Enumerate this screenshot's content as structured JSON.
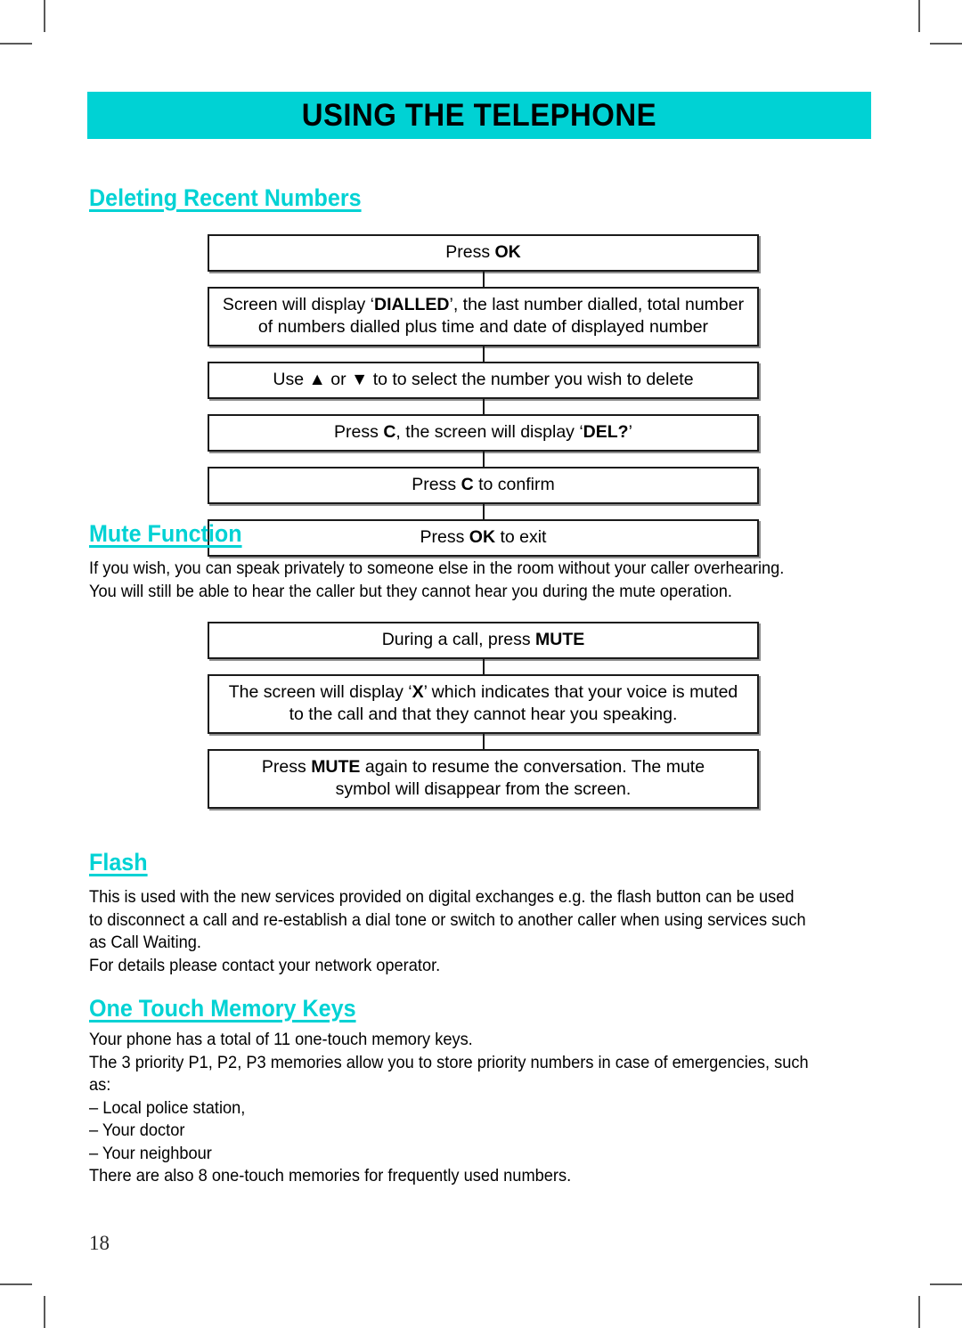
{
  "banner": {
    "title": "USING THE TELEPHONE"
  },
  "sections": {
    "deleting": {
      "heading": "Deleting Recent Numbers",
      "steps": [
        {
          "lines": [
            {
              "text": "Press ",
              "bold": false
            },
            {
              "text": "OK",
              "bold": true
            }
          ]
        },
        {
          "lines": [
            {
              "text": "Screen will display ‘",
              "bold": false
            },
            {
              "text": "DIALLED",
              "bold": true
            },
            {
              "text": "’, the last number dialled, total number",
              "bold": false
            },
            {
              "text": "|BR|",
              "bold": false
            },
            {
              "text": "of numbers dialled plus time and date of displayed number",
              "bold": false
            }
          ]
        },
        {
          "lines": [
            {
              "text": "Use ▲ or ▼ to to select the number you wish to delete",
              "bold": false
            }
          ]
        },
        {
          "lines": [
            {
              "text": "Press ",
              "bold": false
            },
            {
              "text": "C",
              "bold": true
            },
            {
              "text": ", the screen will display ‘",
              "bold": false
            },
            {
              "text": "DEL?",
              "bold": true
            },
            {
              "text": "’",
              "bold": false
            }
          ]
        },
        {
          "lines": [
            {
              "text": "Press ",
              "bold": false
            },
            {
              "text": "C",
              "bold": true
            },
            {
              "text": " to confirm",
              "bold": false
            }
          ]
        },
        {
          "lines": [
            {
              "text": "Press ",
              "bold": false
            },
            {
              "text": "OK",
              "bold": true
            },
            {
              "text": " to exit",
              "bold": false
            }
          ]
        }
      ]
    },
    "mute": {
      "heading": "Mute Function",
      "paragraph": [
        "If you wish, you can speak privately to someone else in the room without your caller overhearing.",
        "You will still be able to hear the caller but they cannot hear you during the mute operation."
      ],
      "steps": [
        {
          "lines": [
            {
              "text": "During a call, press ",
              "bold": false
            },
            {
              "text": "MUTE",
              "bold": true
            }
          ]
        },
        {
          "lines": [
            {
              "text": "The screen will display ‘",
              "bold": false
            },
            {
              "text": "X",
              "bold": true
            },
            {
              "text": "’ which indicates that your voice is muted",
              "bold": false
            },
            {
              "text": "|BR|",
              "bold": false
            },
            {
              "text": "to the call and that they cannot hear you speaking.",
              "bold": false
            }
          ]
        },
        {
          "lines": [
            {
              "text": "Press ",
              "bold": false
            },
            {
              "text": "MUTE",
              "bold": true
            },
            {
              "text": " again to resume the conversation. The mute",
              "bold": false
            },
            {
              "text": "|BR|",
              "bold": false
            },
            {
              "text": "symbol will disappear from the screen.",
              "bold": false
            }
          ]
        }
      ]
    },
    "flash": {
      "heading": "Flash",
      "paragraph": [
        "This is used with the new services provided on digital exchanges e.g. the flash button can be used",
        "to disconnect a call and re-establish a dial tone or switch to another caller when using services such",
        "as Call Waiting.",
        "For details please contact your network operator."
      ]
    },
    "one_touch": {
      "heading": "One Touch Memory Keys",
      "paragraph": [
        "Your phone has a total of 11 one-touch memory keys.",
        "The 3 priority P1, P2, P3 memories allow you to store priority numbers in case of emergencies, such",
        "as:",
        "– Local police station,",
        "– Your doctor",
        "– Your neighbour",
        "There are also 8 one-touch memories for frequently used numbers."
      ]
    }
  },
  "footer": {
    "page_number": "18"
  },
  "colors": {
    "accent": "#00d2d4",
    "text": "#000000",
    "box_border": "#1a1a1a",
    "box_shadow": "#8e8e8e"
  }
}
